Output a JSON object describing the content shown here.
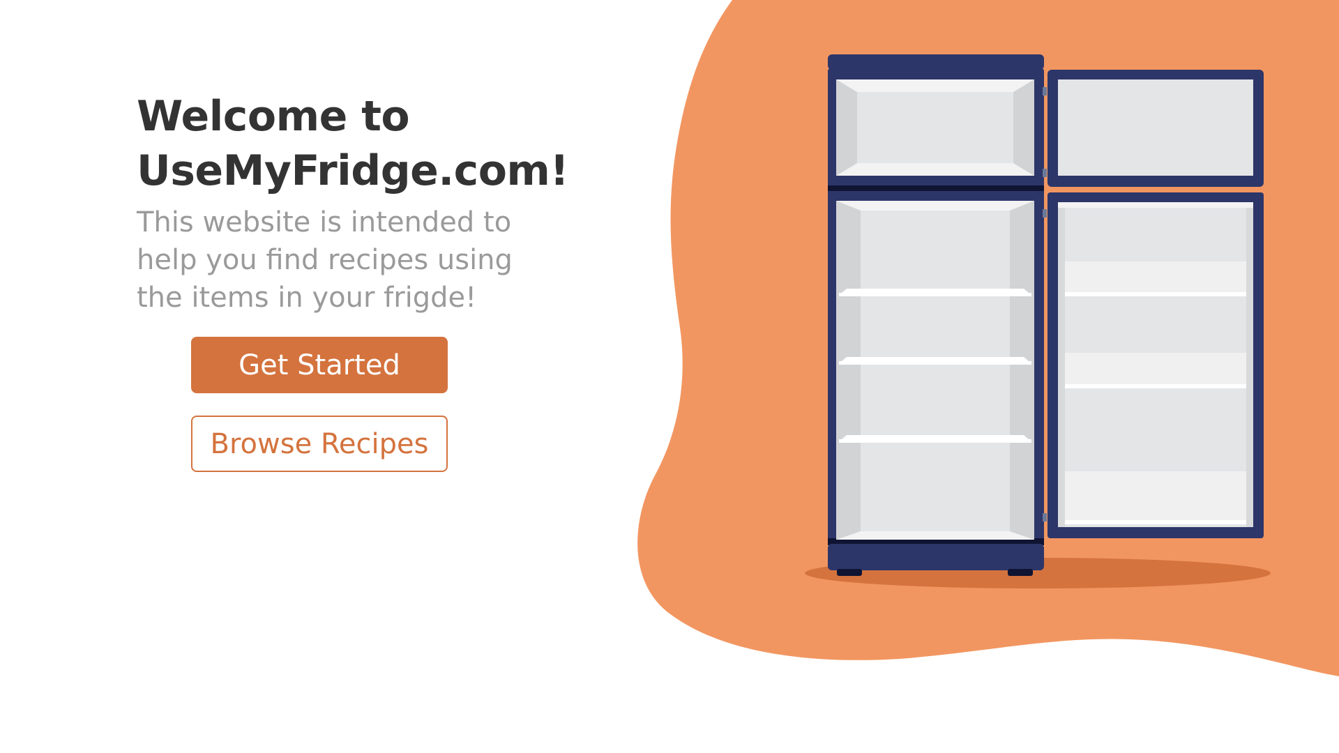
{
  "hero": {
    "title_line1": "Welcome to",
    "title_line2": "UseMyFridge.com!",
    "description": "This website is intended to help you find recipes using the items in your frigde!"
  },
  "buttons": {
    "get_started": "Get Started",
    "browse_recipes": "Browse Recipes"
  },
  "colors": {
    "blob": "#f29661",
    "accent": "#d4733e",
    "fridge_body": "#2d3669",
    "fridge_interior": "#e4e5e7",
    "title": "#333333",
    "description": "#9a9a9a"
  },
  "illustration": {
    "icon": "open-fridge-illustration"
  }
}
